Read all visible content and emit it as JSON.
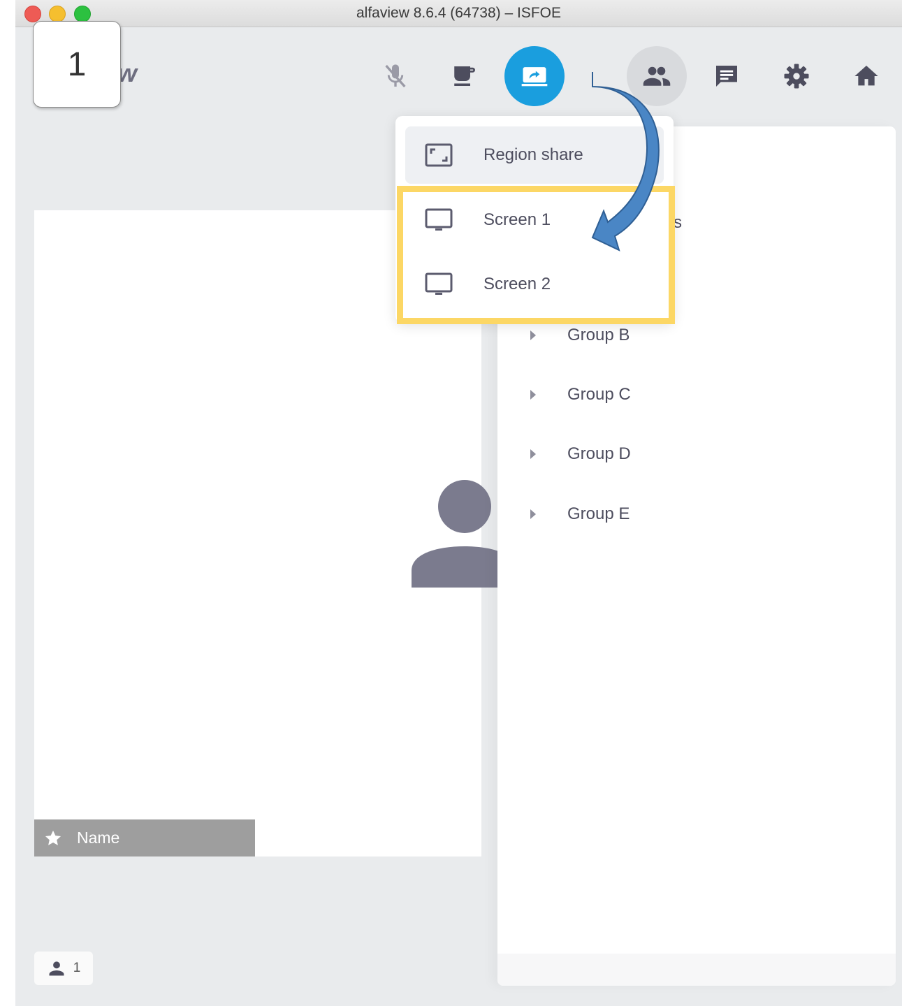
{
  "window": {
    "title": "alfaview 8.6.4 (64738) – ISFOE"
  },
  "step_badge": "1",
  "logo_fragment": "w",
  "toolbar": {
    "buttons": [
      {
        "name": "microphone-off",
        "icon": "mic-off-icon"
      },
      {
        "name": "coffee-break",
        "icon": "coffee-icon"
      },
      {
        "name": "screen-share",
        "icon": "screen-share-icon",
        "active": true
      },
      {
        "name": "participants",
        "icon": "people-icon"
      },
      {
        "name": "chat",
        "icon": "chat-icon"
      },
      {
        "name": "settings",
        "icon": "gear-icon"
      },
      {
        "name": "home",
        "icon": "home-icon"
      }
    ]
  },
  "share_menu": {
    "items": [
      {
        "label": "Region share",
        "icon": "region-icon"
      },
      {
        "label": "Screen 1",
        "icon": "monitor-icon"
      },
      {
        "label": "Screen 2",
        "icon": "monitor-icon"
      }
    ]
  },
  "groups": [
    "Group B",
    "Group C",
    "Group D",
    "Group E"
  ],
  "clipped_text": "s",
  "video": {
    "name_label": "Name"
  },
  "participant_count": "1",
  "colors": {
    "accent": "#1a9ede",
    "highlight_frame": "#fcd765",
    "annotation_arrow": "#4a86c5",
    "icon_gray": "#5b5b6e"
  }
}
